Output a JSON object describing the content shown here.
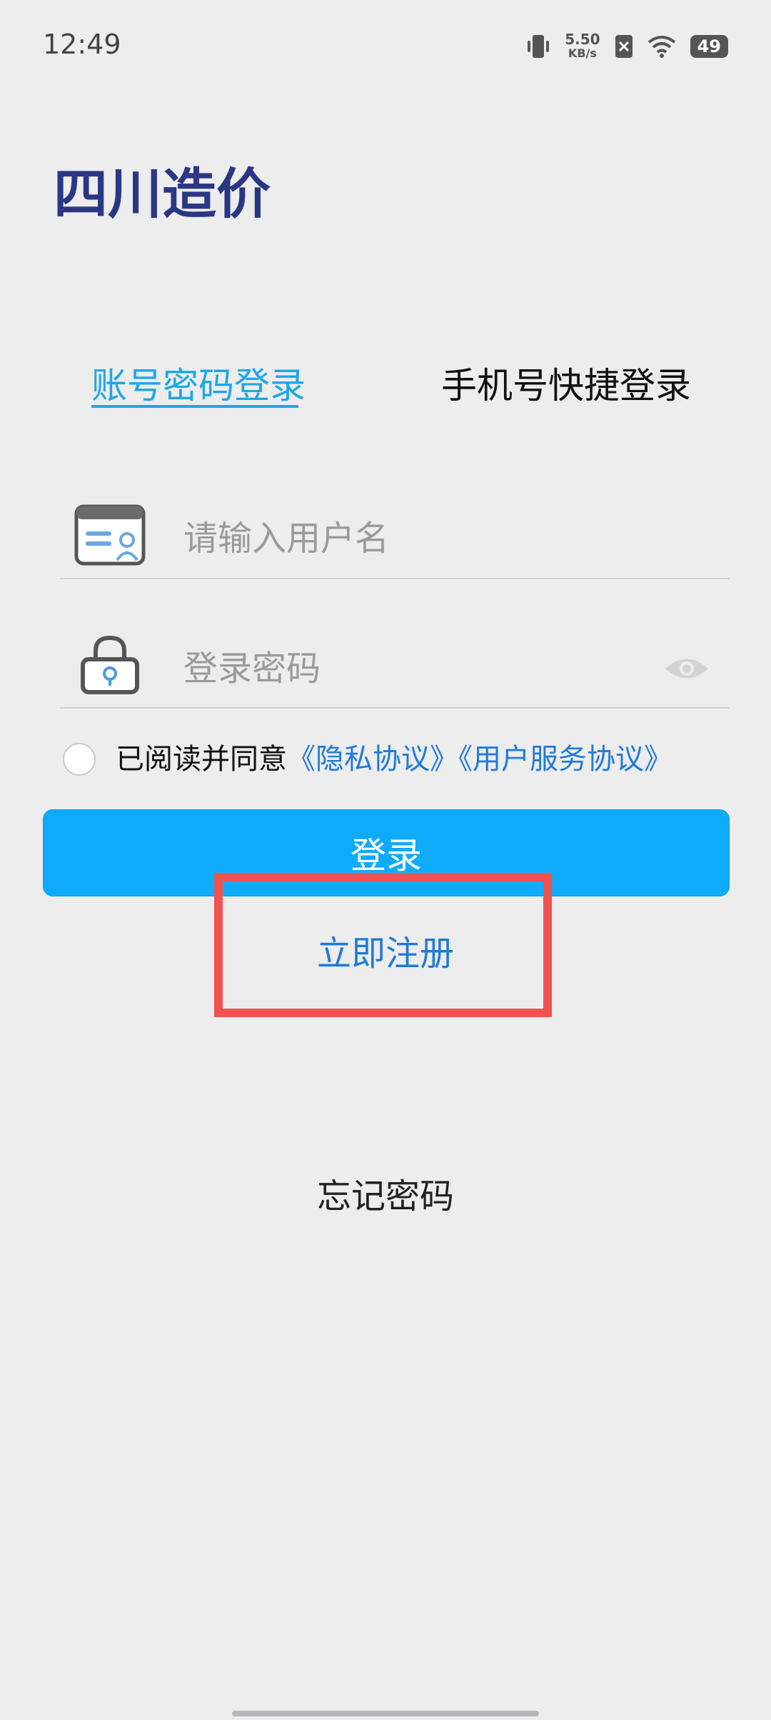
{
  "status_bar": {
    "time": "12:49",
    "net_speed": "5.50",
    "net_unit": "KB/s",
    "battery": "49"
  },
  "app": {
    "title": "四川造价"
  },
  "tabs": [
    {
      "label": "账号密码登录",
      "active": true
    },
    {
      "label": "手机号快捷登录",
      "active": false
    }
  ],
  "form": {
    "username_placeholder": "请输入用户名",
    "password_placeholder": "登录密码"
  },
  "agreement": {
    "prefix": "已阅读并同意",
    "privacy": "《隐私协议》",
    "service": "《用户服务协议》"
  },
  "buttons": {
    "login": "登录",
    "register": "立即注册",
    "forgot": "忘记密码"
  },
  "colors": {
    "accent": "#1ea7e5",
    "login_button": "#0fabfb",
    "title": "#2b3784",
    "link": "#1e7bd8",
    "highlight": "#ef5350"
  }
}
